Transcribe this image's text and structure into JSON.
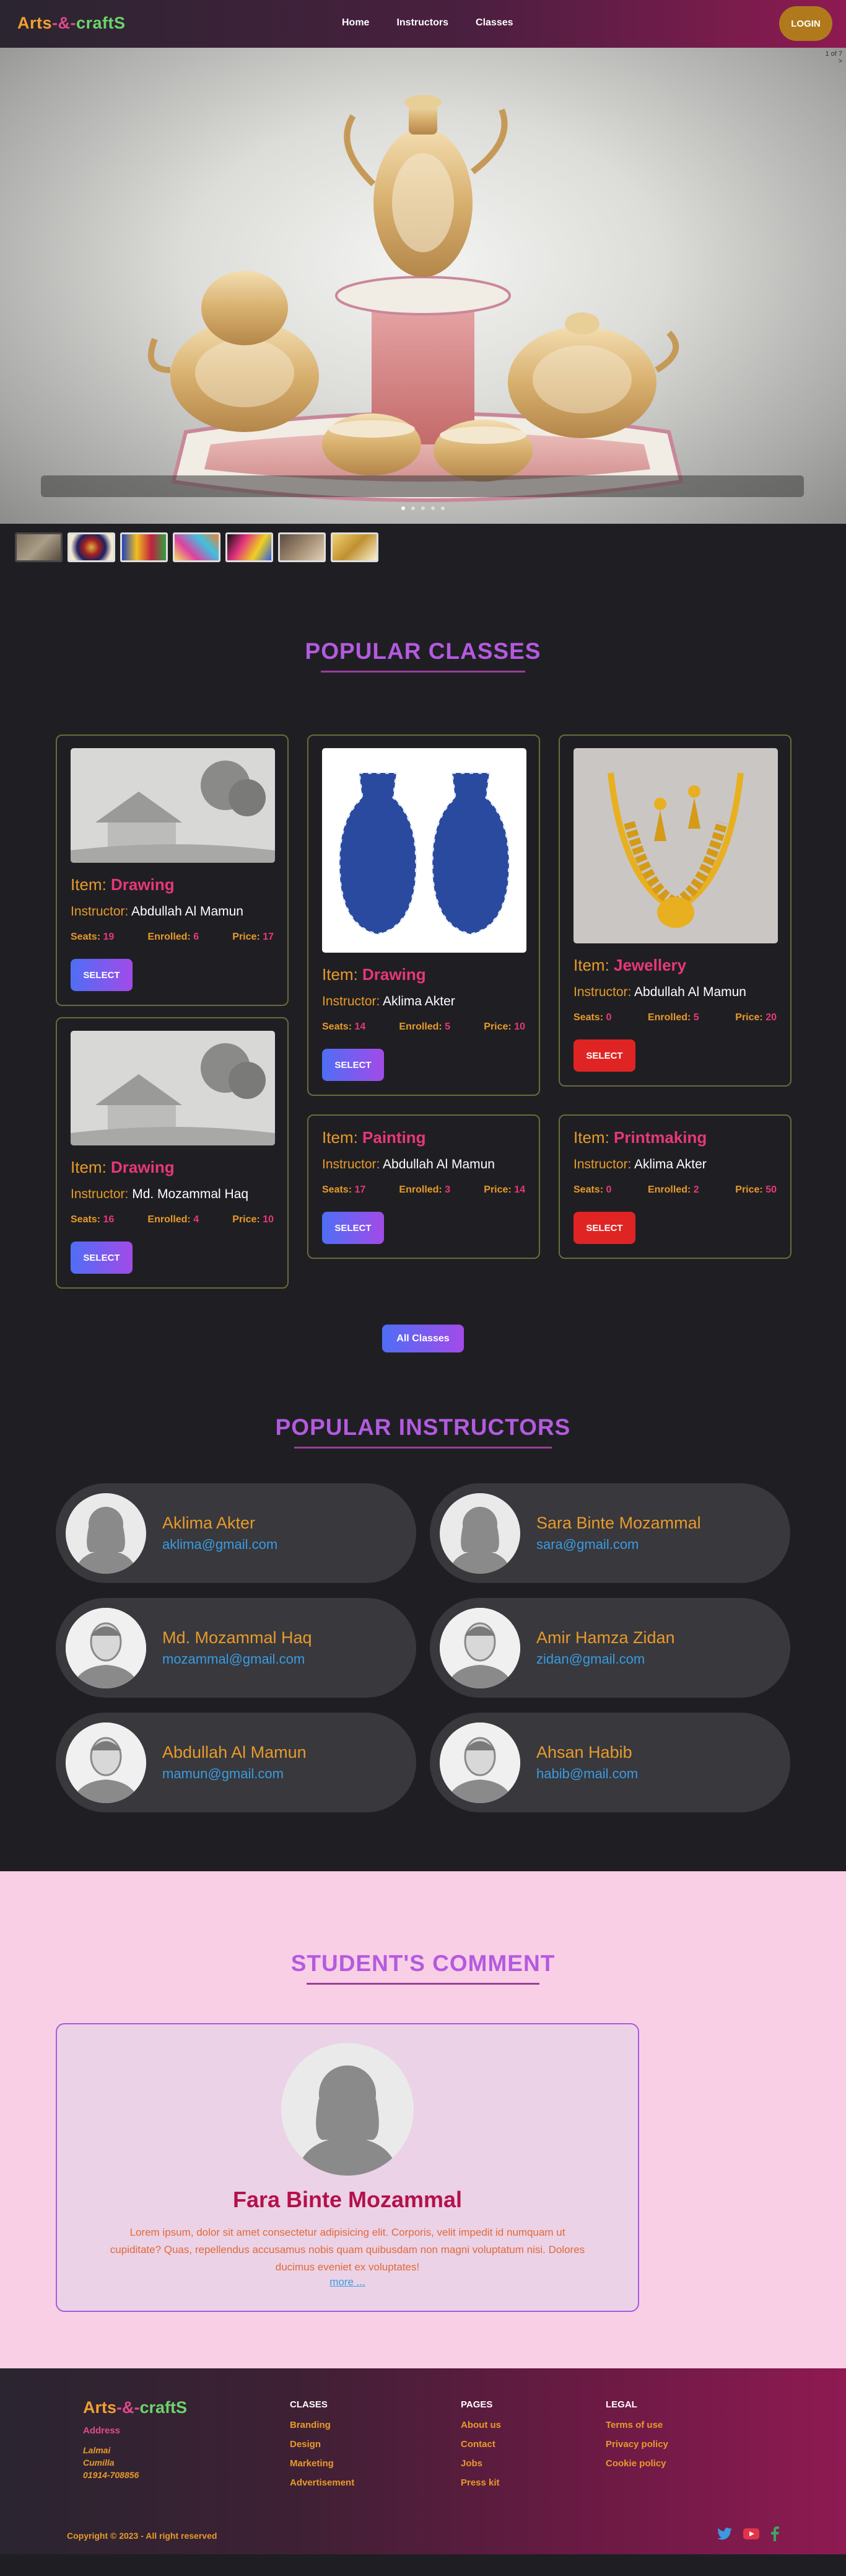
{
  "nav": {
    "logo": {
      "part1": "Arts",
      "part2": "-&-",
      "part3": "craftS"
    },
    "links": [
      "Home",
      "Instructors",
      "Classes"
    ],
    "login": "LOGIN"
  },
  "hero": {
    "counter": "1 of 7",
    "counter_next": ">"
  },
  "classes": {
    "title": "POPULAR CLASSES",
    "item_label": "Item: ",
    "instructor_label": "Instructor: ",
    "seats_label": "Seats: ",
    "enrolled_label": "Enrolled: ",
    "price_label": "Price: ",
    "cards": [
      {
        "item": "Drawing",
        "instructor": "Abdullah Al Mamun",
        "seats": "19",
        "enrolled": "6",
        "price": "17",
        "button": "SELECT"
      },
      {
        "item": "Drawing",
        "instructor": "Aklima Akter",
        "seats": "14",
        "enrolled": "5",
        "price": "10",
        "button": "SELECT"
      },
      {
        "item": "Jewellery",
        "instructor": "Abdullah Al Mamun",
        "seats": "0",
        "enrolled": "5",
        "price": "20",
        "button": "SELECT"
      },
      {
        "item": "Drawing",
        "instructor": "Md. Mozammal Haq",
        "seats": "16",
        "enrolled": "4",
        "price": "10",
        "button": "SELECT"
      },
      {
        "item": "Painting",
        "instructor": "Abdullah Al Mamun",
        "seats": "17",
        "enrolled": "3",
        "price": "14",
        "button": "SELECT"
      },
      {
        "item": "Printmaking",
        "instructor": "Aklima Akter",
        "seats": "0",
        "enrolled": "2",
        "price": "50",
        "button": "SELECT"
      }
    ],
    "all_button": "All Classes"
  },
  "instructors": {
    "title": "POPULAR INSTRUCTORS",
    "list": [
      {
        "name": "Aklima Akter",
        "email": "aklima@gmail.com"
      },
      {
        "name": "Sara Binte Mozammal",
        "email": "sara@gmail.com"
      },
      {
        "name": "Md. Mozammal Haq",
        "email": "mozammal@gmail.com"
      },
      {
        "name": "Amir Hamza Zidan",
        "email": "zidan@gmail.com"
      },
      {
        "name": "Abdullah Al Mamun",
        "email": "mamun@gmail.com"
      },
      {
        "name": "Ahsan Habib",
        "email": "habib@mail.com"
      }
    ]
  },
  "comments": {
    "title": "STUDENT'S COMMENT",
    "name": "Fara Binte Mozammal",
    "text": "Lorem ipsum, dolor sit amet consectetur adipisicing elit. Corporis, velit impedit id numquam ut cupiditate? Quas, repellendus accusamus nobis quam quibusdam non magni voluptatum nisi. Dolores ducimus eveniet ex voluptates!",
    "more": "more ..."
  },
  "footer": {
    "logo": {
      "part1": "Arts",
      "part2": "-&-",
      "part3": "craftS"
    },
    "address_label": "Address",
    "address_lines": [
      "Lalmai",
      "Cumilla",
      "01914-708856"
    ],
    "col1": {
      "title": "CLASES",
      "links": [
        "Branding",
        "Design",
        "Marketing",
        "Advertisement"
      ]
    },
    "col2": {
      "title": "PAGES",
      "links": [
        "About us",
        "Contact",
        "Jobs",
        "Press kit"
      ]
    },
    "col3": {
      "title": "LEGAL",
      "links": [
        "Terms of use",
        "Privacy policy",
        "Cookie policy"
      ]
    },
    "copyright": "Copyright © 2023 - All right reserved",
    "social_icons": [
      "twitter-icon",
      "youtube-icon",
      "facebook-icon"
    ]
  },
  "colors": {
    "accent_orange": "#e89a2a",
    "accent_pink": "#e8377a",
    "title_purple": "#b45ae0",
    "link_blue": "#3a9ce0"
  }
}
